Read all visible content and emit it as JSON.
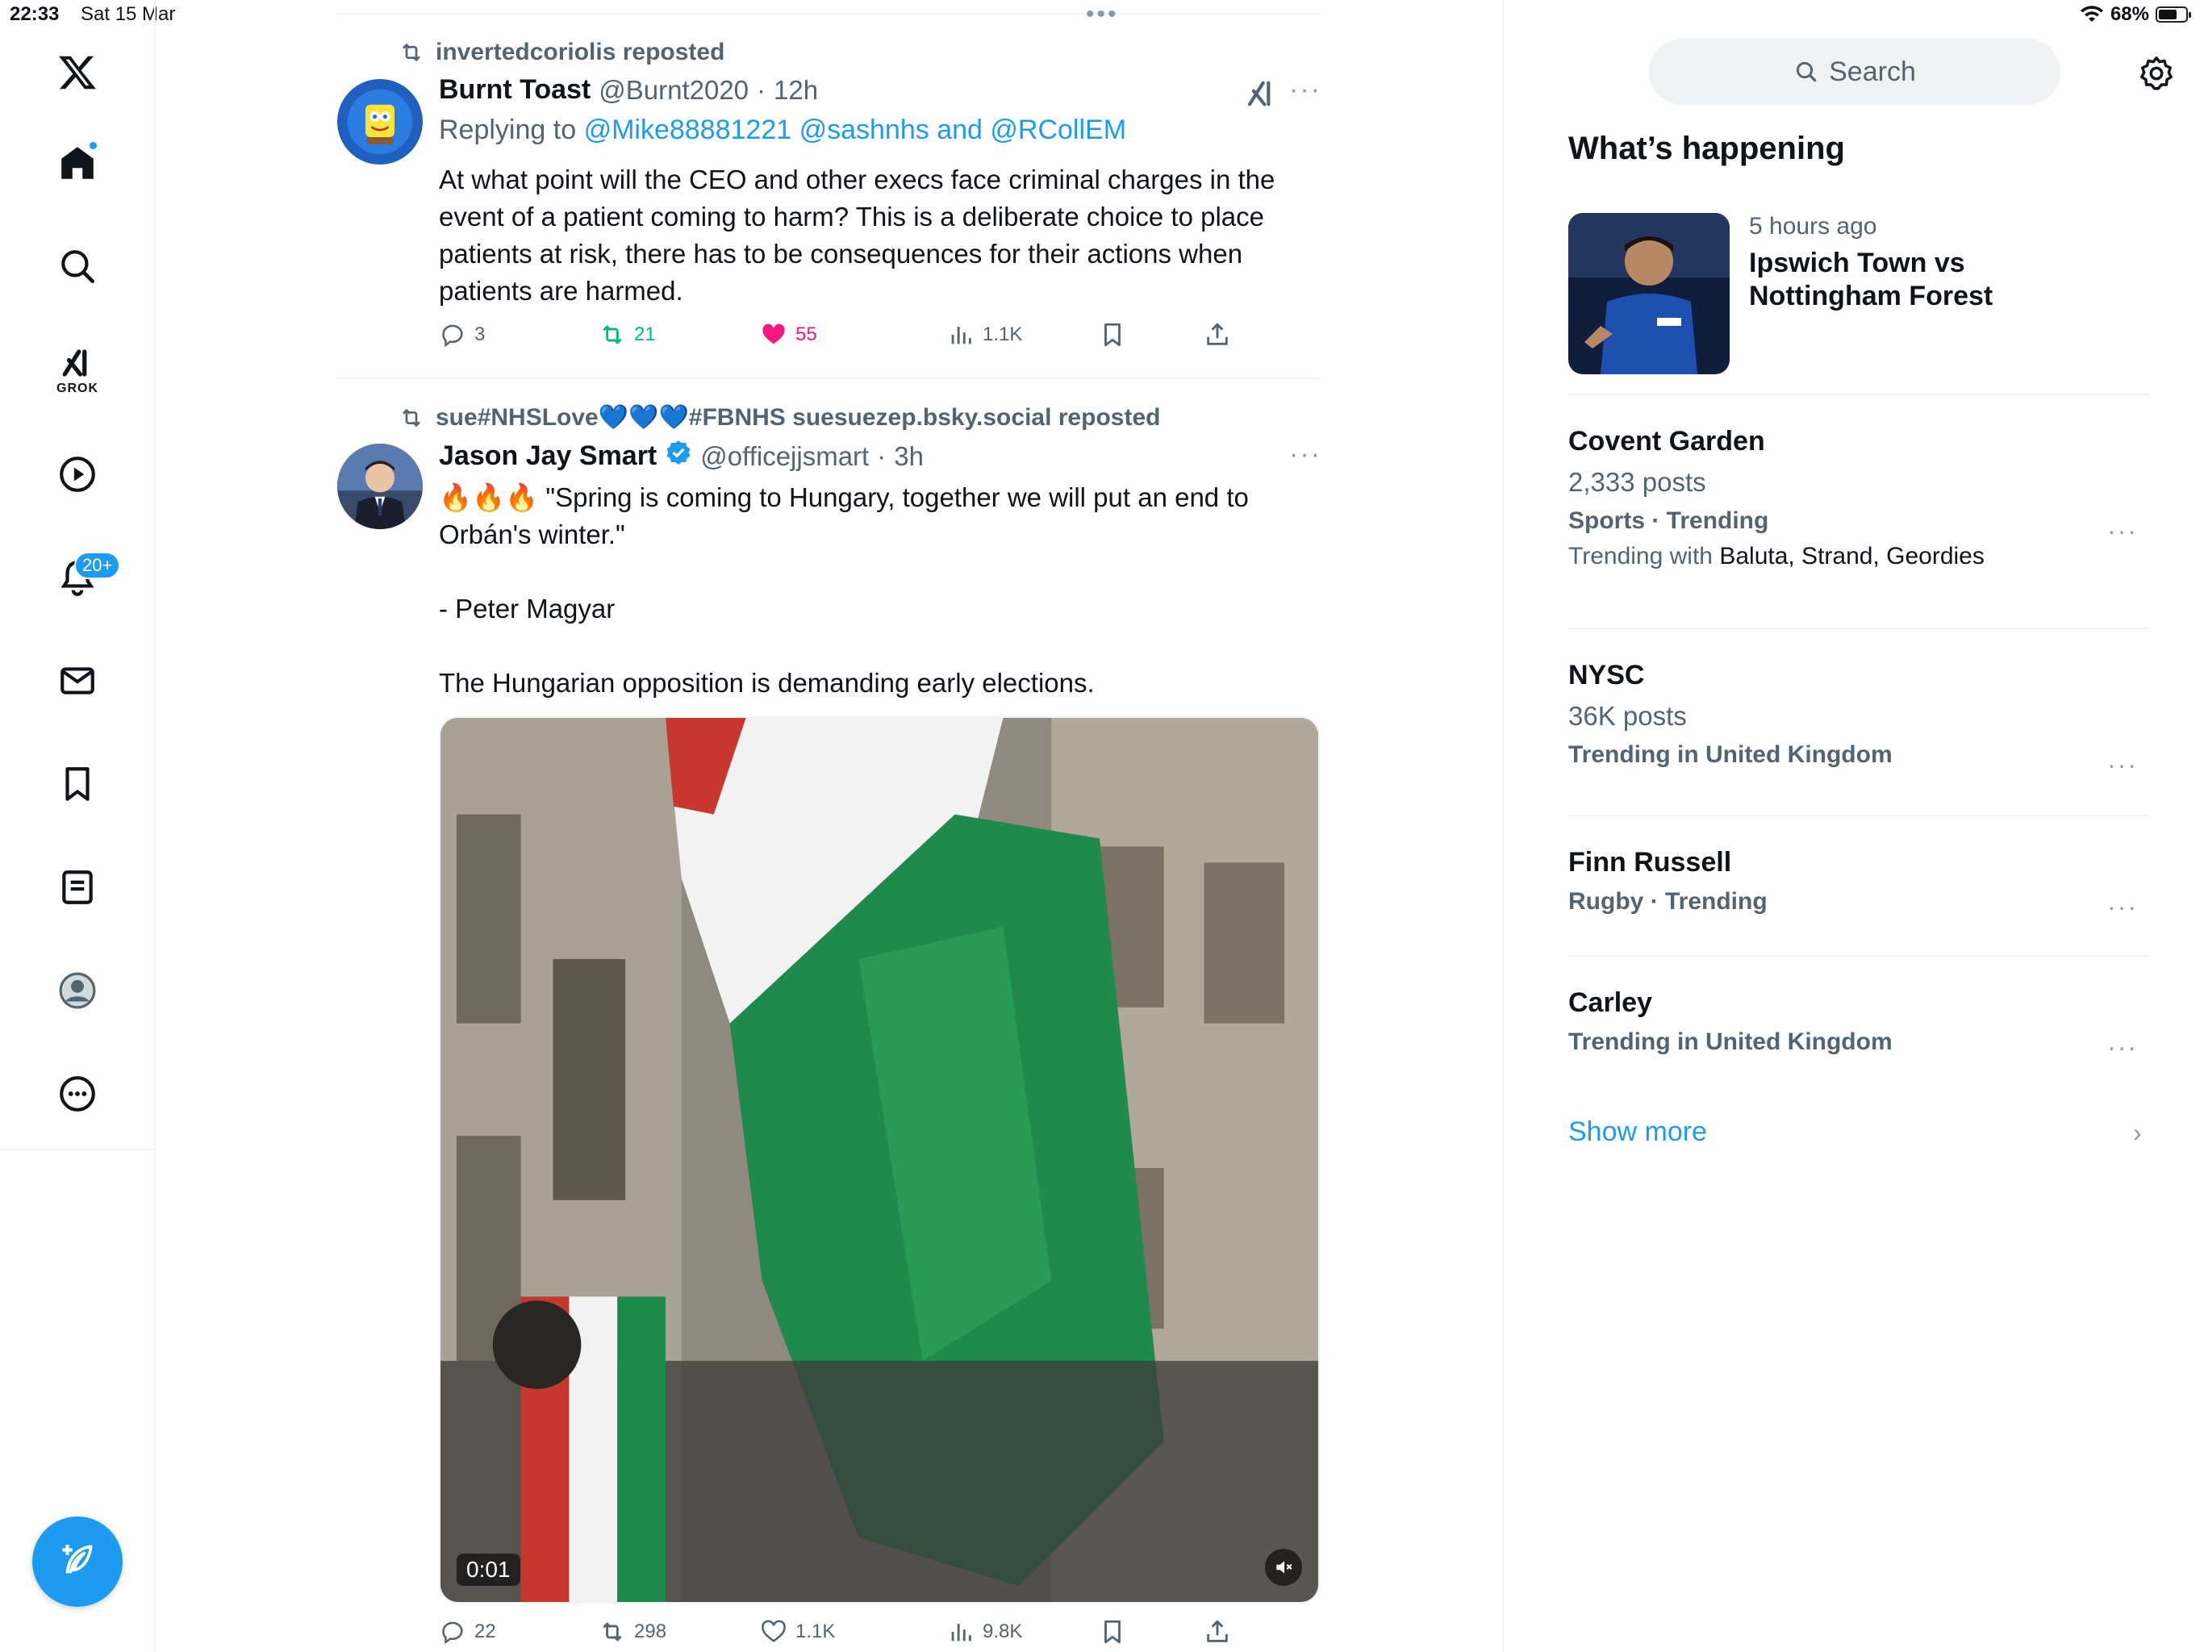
{
  "status_bar": {
    "time": "22:33",
    "date": "Sat 15 Mar",
    "battery": "68%",
    "battery_level": 0.68
  },
  "nav": {
    "grok_label": "GROK",
    "notifications_badge": "20+"
  },
  "tweets": [
    {
      "reposted_by": "invertedcoriolis reposted",
      "author_name": "Burnt Toast",
      "handle": "@Burnt2020",
      "separator": "·",
      "time": "12h",
      "replying_prefix": "Replying to",
      "replying_mentions": "@Mike88881221 @sashnhs",
      "replying_and": "and",
      "replying_last": "@RCollEM",
      "text_lines": [
        "At what point will the CEO and other execs face criminal charges in the event of a patient coming to harm? This is a deliberate choice to place patients at risk, there has to be consequences for their actions when patients are harmed."
      ],
      "replies": "3",
      "reposts": "21",
      "likes": "55",
      "views": "1.1K"
    },
    {
      "reposted_by": "sue#NHSLove💙💙💙#FBNHS suesuezep.bsky.social reposted",
      "author_name": "Jason Jay Smart",
      "handle": "@officejjsmart",
      "separator": "·",
      "time": "3h",
      "text_lines": [
        "🔥🔥🔥 \"Spring is coming to Hungary, together we will put an end to Orbán's winter.\"",
        "",
        "- Peter Magyar",
        "",
        "The Hungarian opposition is demanding early elections."
      ],
      "video_time": "0:01",
      "replies": "22",
      "reposts": "298",
      "likes": "1.1K",
      "views": "9.8K"
    }
  ],
  "right": {
    "search_placeholder": "Search",
    "section_title": "What’s happening",
    "featured": {
      "meta": "5 hours ago",
      "title": "Ipswich Town vs Nottingham Forest"
    },
    "trends": [
      {
        "name": "Covent Garden",
        "posts": "2,333 posts",
        "context": "Sports · Trending",
        "with_label": "Trending with",
        "with_names": "Baluta, Strand, Geordies"
      },
      {
        "name": "NYSC",
        "posts": "36K posts",
        "context": "Trending in United Kingdom"
      },
      {
        "name": "Finn Russell",
        "context": "Rugby · Trending"
      },
      {
        "name": "Carley",
        "context": "Trending in United Kingdom"
      }
    ],
    "show_more": "Show more"
  },
  "colors": {
    "accent": "#1d9bf0",
    "repost_green": "#00ba7c",
    "like_pink": "#f91880",
    "secondary_text": "#536471"
  }
}
